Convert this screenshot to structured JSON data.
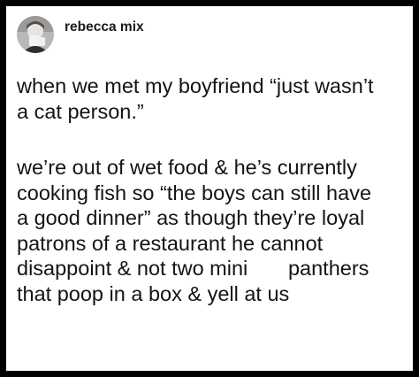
{
  "post": {
    "author": "rebecca mix",
    "avatar_icon": "profile-photo-avatar",
    "paragraph1_lines": [
      "when we met my boyfriend “just wasn’t",
      "a cat person.”"
    ],
    "paragraph2_lines": [
      "we’re out of wet food & he’s currently",
      "cooking fish so “the boys can still have",
      "a good dinner” as though they’re loyal",
      "patrons of a restaurant he cannot",
      "disappoint & not two mini       panthers",
      "that poop in a box & yell at us"
    ]
  },
  "colors": {
    "border": "#000000",
    "background": "#ffffff",
    "text": "#141414"
  }
}
